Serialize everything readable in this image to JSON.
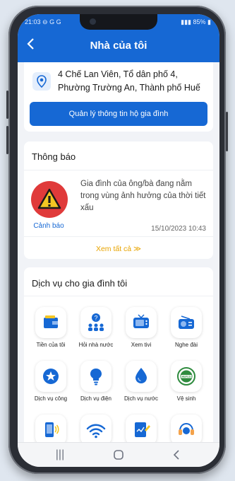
{
  "status": {
    "time": "21:03",
    "left_icons": "⊖ G G",
    "right": "85%"
  },
  "appbar": {
    "title": "Nhà của tôi",
    "back_icon": "chevron-left-icon"
  },
  "address": {
    "text": "4 Chế Lan Viên, Tổ dân phố 4, Phường Trường An, Thành phố Huế",
    "manage_button": "Quản lý thông tin hộ gia đình"
  },
  "notifications": {
    "title": "Thông báo",
    "item": {
      "label": "Cảnh báo",
      "message": "Gia đình của ông/bà đang nằm trong vùng ảnh hưởng của thời tiết xấu",
      "time": "15/10/2023 10:43"
    },
    "see_all": "Xem tất cả ≫"
  },
  "services": {
    "title": "Dịch vụ cho gia đình tôi",
    "items": [
      {
        "label": "Tiền của tôi",
        "icon": "wallet-icon"
      },
      {
        "label": "Hỏi nhà nước",
        "icon": "question-people-icon"
      },
      {
        "label": "Xem tivi",
        "icon": "tv-icon"
      },
      {
        "label": "Nghe đài",
        "icon": "radio-icon"
      },
      {
        "label": "Dịch vụ công",
        "icon": "public-service-icon"
      },
      {
        "label": "Dịch vụ điện",
        "icon": "lightbulb-icon"
      },
      {
        "label": "Dịch vụ nước",
        "icon": "water-drop-icon"
      },
      {
        "label": "Vệ sinh",
        "icon": "hepco-logo-icon"
      },
      {
        "label": "",
        "icon": "phone-call-icon"
      },
      {
        "label": "",
        "icon": "wifi-icon"
      },
      {
        "label": "",
        "icon": "document-sign-icon"
      },
      {
        "label": "",
        "icon": "support-headset-icon"
      }
    ]
  },
  "colors": {
    "primary": "#1668d4",
    "warning": "#e03a3a",
    "accent": "#e8a400"
  }
}
